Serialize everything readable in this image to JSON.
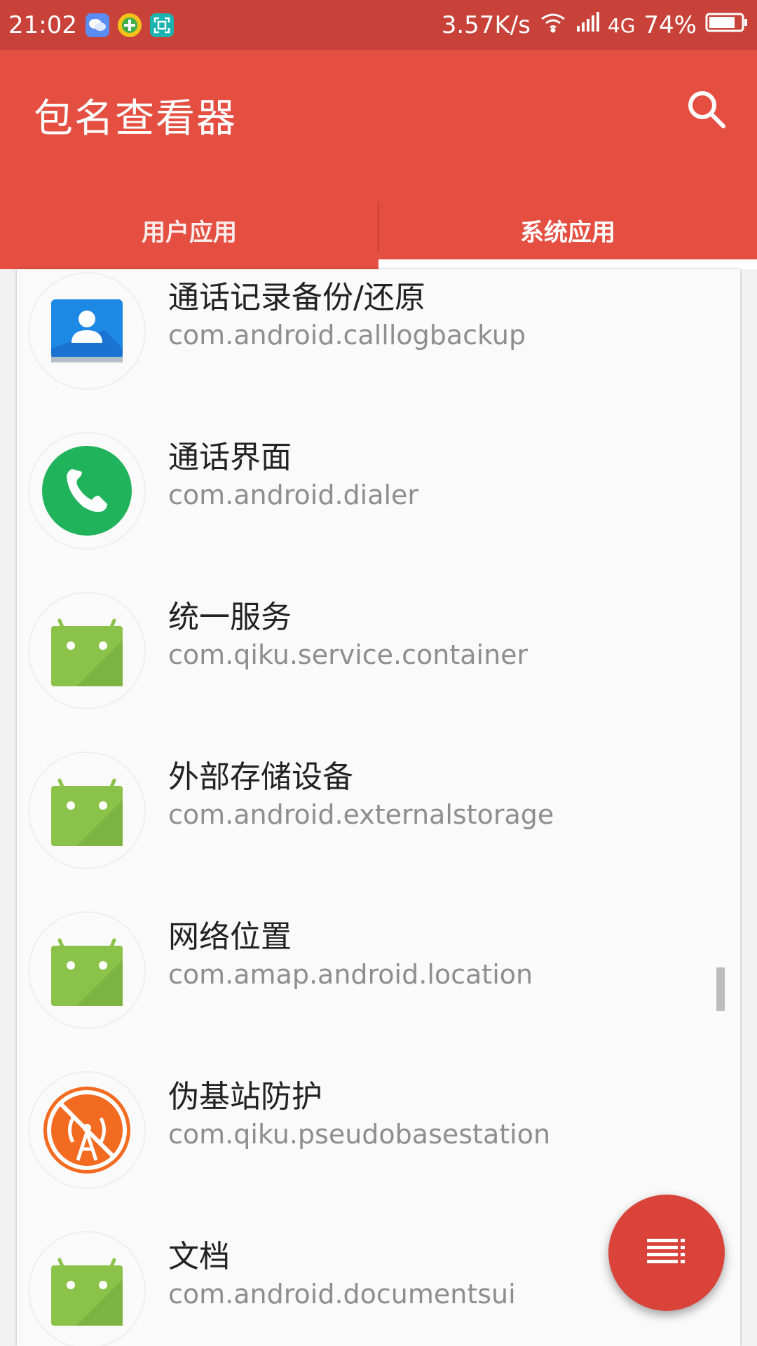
{
  "status_bar": {
    "time": "21:02",
    "net_speed": "3.57K/s",
    "network_type": "4G",
    "battery": "74%",
    "notification_icons": [
      "wechat-icon",
      "plus-app-icon",
      "scan-icon"
    ]
  },
  "app_bar": {
    "title": "包名查看器",
    "search_icon": "search-icon"
  },
  "tabs": [
    {
      "label": "用户应用",
      "selected": false
    },
    {
      "label": "系统应用",
      "selected": true
    }
  ],
  "apps": [
    {
      "name": "通话记录备份/还原",
      "package": "com.android.calllogbackup",
      "icon": "contact-backup-icon"
    },
    {
      "name": "通话界面",
      "package": "com.android.dialer",
      "icon": "phone-icon"
    },
    {
      "name": "统一服务",
      "package": "com.qiku.service.container",
      "icon": "android-icon"
    },
    {
      "name": "外部存储设备",
      "package": "com.android.externalstorage",
      "icon": "android-icon"
    },
    {
      "name": "网络位置",
      "package": "com.amap.android.location",
      "icon": "android-icon"
    },
    {
      "name": "伪基站防护",
      "package": "com.qiku.pseudobasestation",
      "icon": "antenna-block-icon"
    },
    {
      "name": "文档",
      "package": "com.android.documentsui",
      "icon": "android-icon"
    }
  ],
  "fab": {
    "icon": "menu-sort-icon"
  },
  "colors": {
    "status_bar": "#c84239",
    "app_bar": "#e54f42",
    "fab": "#d9433a",
    "android_green": "#8bc34a"
  }
}
